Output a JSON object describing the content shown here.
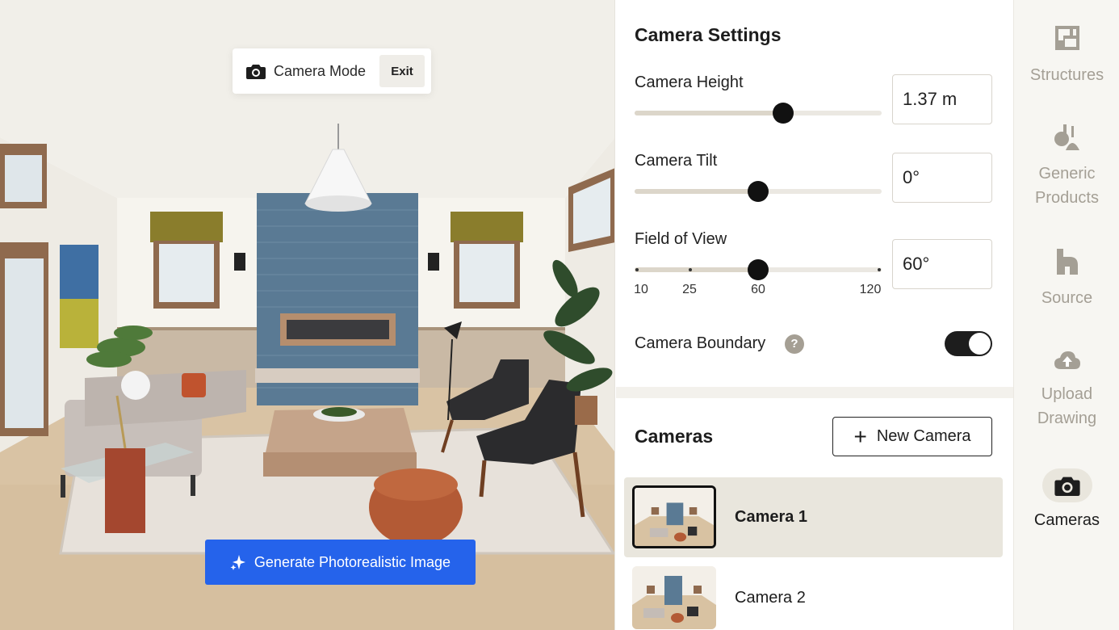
{
  "camera_mode": {
    "label": "Camera Mode",
    "exit_label": "Exit",
    "icon": "camera-icon"
  },
  "generate_button": {
    "label": "Generate Photorealistic Image",
    "icon": "sparkle-icon",
    "color": "#2563eb"
  },
  "settings": {
    "title": "Camera Settings",
    "camera_height": {
      "label": "Camera Height",
      "value": "1.37 m",
      "slider_fraction": 0.6
    },
    "camera_tilt": {
      "label": "Camera Tilt",
      "value": "0°",
      "slider_fraction": 0.5
    },
    "field_of_view": {
      "label": "Field of View",
      "value": "60°",
      "slider_value": 60,
      "ticks": [
        "10",
        "25",
        "60",
        "120"
      ]
    },
    "camera_boundary": {
      "label": "Camera Boundary",
      "help": "?",
      "enabled": true
    }
  },
  "cameras": {
    "title": "Cameras",
    "new_camera_label": "New Camera",
    "items": [
      {
        "name": "Camera 1",
        "selected": true
      },
      {
        "name": "Camera 2",
        "selected": false
      }
    ]
  },
  "rail": {
    "items": [
      {
        "label_line1": "Structures",
        "label_line2": "",
        "icon": "floorplan-icon",
        "active": false
      },
      {
        "label_line1": "Generic",
        "label_line2": "Products",
        "icon": "lamp-icon",
        "active": false
      },
      {
        "label_line1": "Source",
        "label_line2": "",
        "icon": "source-icon",
        "active": false
      },
      {
        "label_line1": "Upload",
        "label_line2": "Drawing",
        "icon": "cloud-upload-icon",
        "active": false
      },
      {
        "label_line1": "Cameras",
        "label_line2": "",
        "icon": "camera-icon",
        "active": true
      }
    ]
  },
  "colors": {
    "accent": "#2563eb",
    "panel_bg": "#ffffff",
    "rail_bg": "#f7f6f2",
    "selected_bg": "#e9e6dd"
  }
}
